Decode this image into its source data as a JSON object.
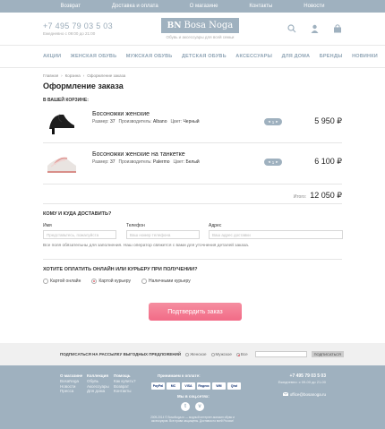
{
  "topnav": [
    "Возврат",
    "Доставка и оплата",
    "О магазине",
    "Контакты",
    "Новости"
  ],
  "header": {
    "phone": "+7 495 79 03 5 03",
    "hours": "Ежедневно с 09:00 до 21:00",
    "logo": "Bosa Noga",
    "logo_mark": "BN",
    "tagline": "Обувь и аксессуары для всей семьи"
  },
  "catnav": [
    "АКЦИИ",
    "ЖЕНСКАЯ ОБУВЬ",
    "МУЖСКАЯ ОБУВЬ",
    "ДЕТСКАЯ ОБУВЬ",
    "АКСЕССУАРЫ",
    "ДЛЯ ДОМА",
    "БРЕНДЫ",
    "НОВИНКИ"
  ],
  "breadcrumbs": [
    "Главная",
    "Корзина",
    "Оформление заказа"
  ],
  "crumb_sep": "›",
  "page_title": "Оформление заказа",
  "cart_title": "В ВАШЕЙ КОРЗИНЕ:",
  "items": [
    {
      "name": "Босоножки женские",
      "size_label": "Размер:",
      "size": "37",
      "maker_label": "Производитель:",
      "maker": "Albano",
      "color_label": "Цвет:",
      "color": "Черный",
      "qty": "1",
      "price": "5 950 ₽"
    },
    {
      "name": "Босоножки женские на танкетке",
      "size_label": "Размер:",
      "size": "37",
      "maker_label": "Производитель:",
      "maker": "Palermo",
      "color_label": "Цвет:",
      "color": "Белый",
      "qty": "1",
      "price": "6 100 ₽"
    }
  ],
  "total_label": "Итого:",
  "total_value": "12 050 ₽",
  "delivery": {
    "title": "КОМУ И КУДА ДОСТАВИТЬ?",
    "name_label": "Имя",
    "name_placeholder": "Представьтесь, пожалуйста",
    "phone_label": "Телефон",
    "phone_placeholder": "Ваш номер телефона",
    "address_label": "Адрес",
    "address_placeholder": "Ваш адрес доставки",
    "note": "Все поля обязательны для заполнения. Наш оператор свяжется с вами для уточнения деталей заказа."
  },
  "payment": {
    "title": "ХОТИТЕ ОПЛАТИТЬ ОНЛАЙН ИЛИ КУРЬЕРУ ПРИ ПОЛУЧЕНИИ?",
    "options": [
      "Картой онлайн",
      "Картой курьеру",
      "Наличными курьеру"
    ],
    "selected": 1
  },
  "confirm_label": "Подтвердить заказ",
  "newsletter": {
    "label": "ПОДПИСАТЬСЯ НА РАССЫЛКУ ВЫГОДНЫХ ПРЕДЛОЖЕНИЙ",
    "options": [
      "Женское",
      "Мужское",
      "Все"
    ],
    "selected": 2,
    "button": "ПОДПИСАТЬСЯ"
  },
  "footer": {
    "col1": {
      "head": "О магазине",
      "items": [
        "BosaNoga",
        "Новости",
        "Пресса"
      ]
    },
    "col2": {
      "head": "Коллекция",
      "items": [
        "Обувь",
        "Аксессуары",
        "Для дома"
      ]
    },
    "col3": {
      "head": "Помощь",
      "items": [
        "Как купить?",
        "Возврат",
        "Контакты"
      ]
    },
    "pay_title": "Принимаем к оплате:",
    "pay_methods": [
      "PayPal",
      "MC",
      "VISA",
      "Яндекс",
      "WM",
      "Qiwi"
    ],
    "social_title": "Мы в соц.сетях:",
    "social": [
      "t",
      "v"
    ],
    "copyright": "2009-2014 © BosaNoga.ru — модный интернет-магазин обуви и аксессуаров. Все права защищены. Доставка по всей России!",
    "phone": "+7 495 79 03 5 03",
    "hours": "Ежедневно: с 09-00 до 21-00",
    "email": "office@bosanoga.ru"
  },
  "colors": {
    "accent": "#9fb1bf",
    "cta": "#f26b87"
  }
}
